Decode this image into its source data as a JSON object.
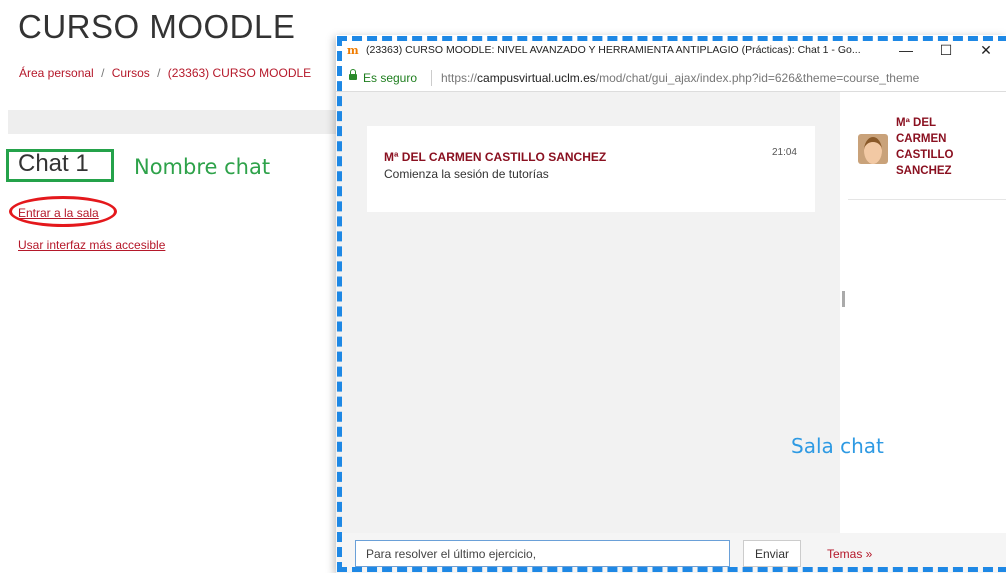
{
  "page": {
    "course_title": "CURSO MOODLE",
    "breadcrumb": [
      "Área personal",
      "Cursos",
      "(23363) CURSO MOODLE"
    ],
    "breadcrumb_sep": "/",
    "chat_name": "Chat 1",
    "annotation_nombre_chat": "Nombre chat",
    "link_enter_room": "Entrar a la sala",
    "link_accessible": "Usar interfaz más accesible"
  },
  "popup": {
    "logo": "m",
    "window_title": "(23363) CURSO MOODLE: NIVEL AVANZADO Y HERRAMIENTA ANTIPLAGIO (Prácticas): Chat 1 - Go...",
    "controls": {
      "minimize": "—",
      "maximize": "☐",
      "close": "✕"
    },
    "secure_label": "Es seguro",
    "url_scheme": "https://",
    "url_host": "campusvirtual.uclm.es",
    "url_path": "/mod/chat/gui_ajax/index.php?id=626&theme=course_theme",
    "messages": [
      {
        "user": "Mª DEL CARMEN CASTILLO SANCHEZ",
        "time": "21:04",
        "text": "Comienza la sesión de tutorías"
      }
    ],
    "users": [
      {
        "name_lines": [
          "Mª DEL",
          "CARMEN",
          "CASTILLO",
          "SANCHEZ"
        ]
      }
    ],
    "input_value": "Para resolver el último ejercicio,",
    "send_label": "Enviar",
    "themes_label": "Temas »",
    "annotation_sala_chat": "Sala chat"
  },
  "colors": {
    "moodle_link": "#b5182a",
    "annotation_green": "#2ea24a",
    "annotation_red": "#e4181c",
    "annotation_blue": "#1e88e5",
    "chat_user": "#8a1020"
  }
}
